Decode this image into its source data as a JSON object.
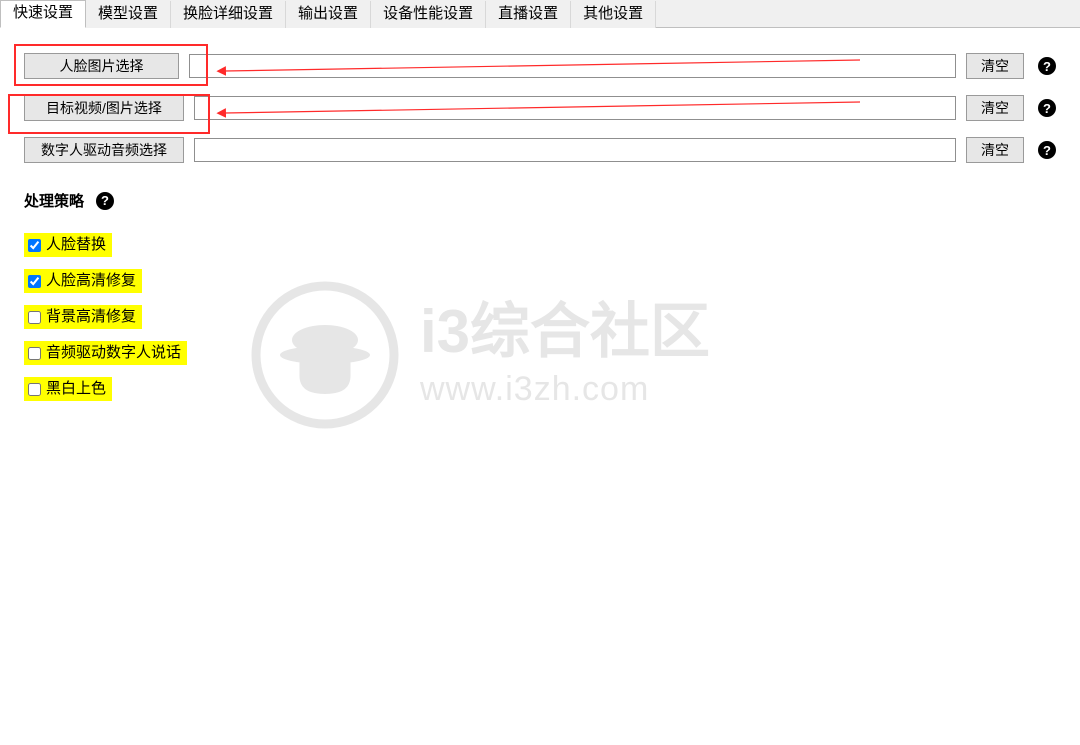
{
  "tabs": [
    {
      "label": "快速设置",
      "active": true
    },
    {
      "label": "模型设置",
      "active": false
    },
    {
      "label": "换脸详细设置",
      "active": false
    },
    {
      "label": "输出设置",
      "active": false
    },
    {
      "label": "设备性能设置",
      "active": false
    },
    {
      "label": "直播设置",
      "active": false
    },
    {
      "label": "其他设置",
      "active": false
    }
  ],
  "rows": [
    {
      "button": "人脸图片选择",
      "value": "",
      "clear": "清空",
      "help": true
    },
    {
      "button": "目标视频/图片选择",
      "value": "",
      "clear": "清空",
      "help": true
    },
    {
      "button": "数字人驱动音频选择",
      "value": "",
      "clear": "清空",
      "help": true
    }
  ],
  "strategy": {
    "title": "处理策略",
    "help": "?"
  },
  "checkboxes": [
    {
      "label": "人脸替换",
      "checked": true
    },
    {
      "label": "人脸高清修复",
      "checked": true
    },
    {
      "label": "背景高清修复",
      "checked": false
    },
    {
      "label": "音频驱动数字人说话",
      "checked": false
    },
    {
      "label": "黑白上色",
      "checked": false
    }
  ],
  "watermark": {
    "title": "i3综合社区",
    "url": "www.i3zh.com"
  }
}
